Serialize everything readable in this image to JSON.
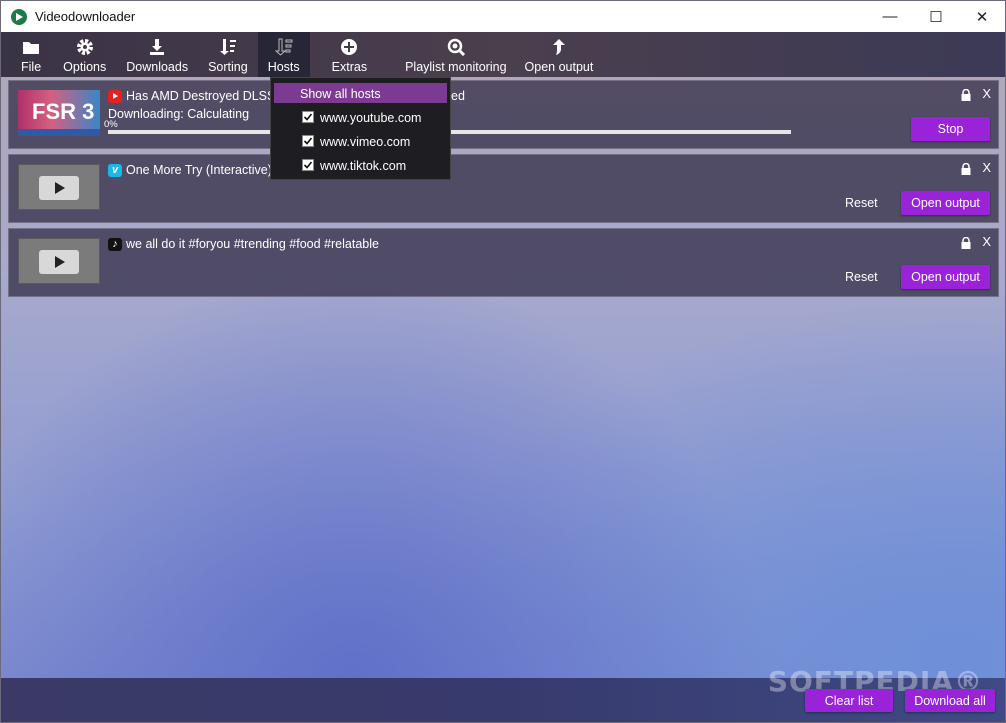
{
  "window": {
    "title": "Videodownloader",
    "minimize": "—",
    "maximize": "☐",
    "close": "✕"
  },
  "toolbar": {
    "file": "File",
    "options": "Options",
    "downloads": "Downloads",
    "sorting": "Sorting",
    "hosts": "Hosts",
    "extras": "Extras",
    "playlist": "Playlist monitoring",
    "open_output": "Open output"
  },
  "hosts_menu": {
    "show_all": "Show all hosts",
    "hosts": [
      "www.youtube.com",
      "www.vimeo.com",
      "www.tiktok.com"
    ]
  },
  "downloads": [
    {
      "title": "Has AMD Destroyed DLSS 3",
      "title_tail": "ed",
      "status": "Downloading: Calculating",
      "progress": "0%",
      "progress_value": 0,
      "action": "Stop",
      "thumb_text": "FSR 3"
    },
    {
      "title": "One More Try (Interactive)",
      "reset": "Reset",
      "action": "Open output"
    },
    {
      "title": "we all do it #foryou #trending #food #relatable",
      "reset": "Reset",
      "action": "Open output"
    }
  ],
  "row_close": "X",
  "bottom": {
    "clear": "Clear list",
    "download_all": "Download all",
    "watermark": "SOFTPEDIA®"
  }
}
